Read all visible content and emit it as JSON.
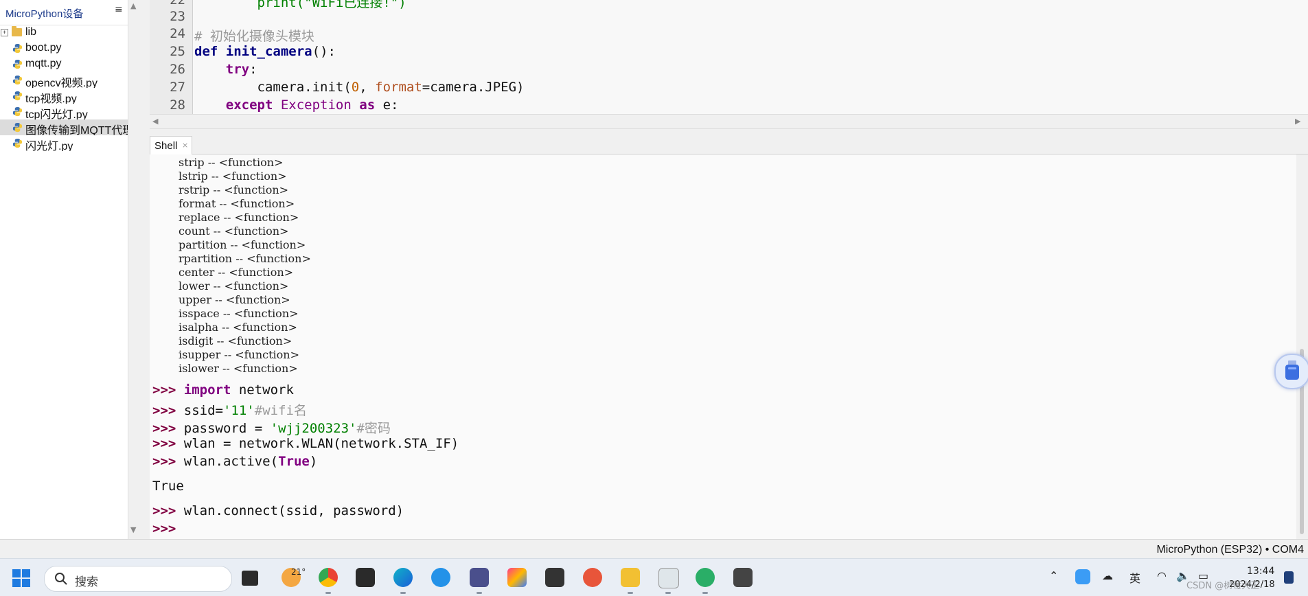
{
  "file_pane": {
    "title": "MicroPython设备",
    "menu_glyph": "≡",
    "items": [
      {
        "label": "lib",
        "type": "folder"
      },
      {
        "label": "boot.py",
        "type": "file"
      },
      {
        "label": "mqtt.py",
        "type": "file"
      },
      {
        "label": "opencv视频.py",
        "type": "file"
      },
      {
        "label": "tcp视频.py",
        "type": "file"
      },
      {
        "label": "tcp闪光灯.py",
        "type": "file"
      },
      {
        "label": "图像传输到MQTT代理",
        "type": "file",
        "selected": true
      },
      {
        "label": "闪光灯.py",
        "type": "file"
      }
    ]
  },
  "editor": {
    "lines": [
      {
        "n": "22",
        "text": "        print(\"WiFi已连接!\")"
      },
      {
        "n": "23",
        "text": ""
      },
      {
        "n": "24",
        "text": "# 初始化摄像头模块"
      },
      {
        "n": "25",
        "text": "def init_camera():"
      },
      {
        "n": "26",
        "text": "    try:"
      },
      {
        "n": "27",
        "text": "        camera.init(0, format=camera.JPEG)"
      },
      {
        "n": "28",
        "text": "    except Exception as e:"
      }
    ]
  },
  "shell": {
    "tab_label": "Shell",
    "tab_close": "×",
    "function_list": [
      "strip -- <function>",
      "lstrip -- <function>",
      "rstrip -- <function>",
      "format -- <function>",
      "replace -- <function>",
      "count -- <function>",
      "partition -- <function>",
      "rpartition -- <function>",
      "center -- <function>",
      "lower -- <function>",
      "upper -- <function>",
      "isspace -- <function>",
      "isalpha -- <function>",
      "isdigit -- <function>",
      "isupper -- <function>",
      "islower -- <function>"
    ],
    "prompt": ">>>",
    "cmd1_kw": "import",
    "cmd1_rest": " network",
    "cmd2_a": "ssid=",
    "cmd2_str": "'11'",
    "cmd2_cm": "#wifi名",
    "cmd3_a": "password = ",
    "cmd3_str": "'wjj200323'",
    "cmd3_cm": "#密码",
    "cmd4": "wlan = network.WLAN(network.STA_IF)",
    "cmd5_a": "wlan.active(",
    "cmd5_kw": "True",
    "cmd5_b": ")",
    "output_true": "True",
    "cmd6": "wlan.connect(ssid, password)"
  },
  "status_bar": {
    "interpreter": "MicroPython (ESP32)  •  COM4"
  },
  "taskbar": {
    "search_label": "搜索",
    "weather": "21°",
    "ime": "英",
    "time": "13:44",
    "date": "2024/2/18",
    "watermark": "CSDN @树莓大王"
  },
  "colors": {
    "keyword": "#800080",
    "string": "#008000",
    "comment": "#9a9a9a",
    "prompt": "#800040"
  }
}
